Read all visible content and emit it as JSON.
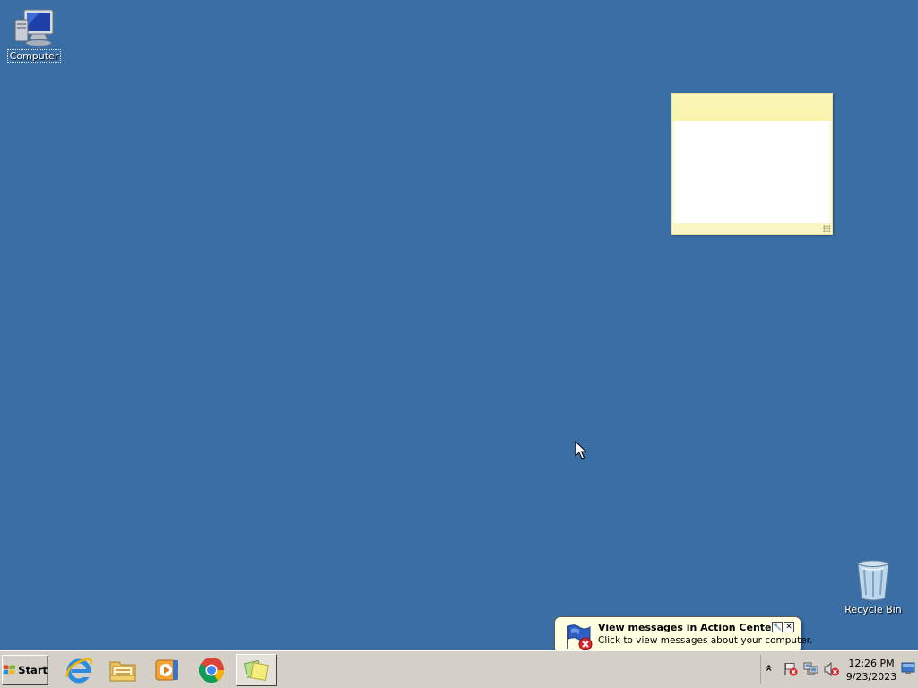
{
  "desktop": {
    "background": "#3a6ea5",
    "icons": [
      {
        "label": "Computer",
        "icon": "computer-icon"
      },
      {
        "label": "Recycle Bin",
        "icon": "recycle-bin-icon"
      }
    ]
  },
  "notification": {
    "title": "View messages in Action Center",
    "text": "Click to view messages about your computer.",
    "icon": "action-center-flag-icon",
    "options_glyph": "🔧",
    "close_glyph": "✕"
  },
  "taskbar": {
    "start_label": "Start",
    "pinned": [
      {
        "name": "Internet Explorer",
        "icon": "internet-explorer-icon"
      },
      {
        "name": "Windows Explorer",
        "icon": "file-explorer-icon"
      },
      {
        "name": "Windows Media Player",
        "icon": "media-player-icon"
      },
      {
        "name": "Google Chrome",
        "icon": "chrome-icon"
      },
      {
        "name": "Sticky Notes",
        "icon": "sticky-notes-icon"
      }
    ],
    "tray": {
      "show_hidden_glyph": "»",
      "icons": [
        "action-center-icon",
        "network-icon",
        "volume-muted-icon"
      ],
      "time": "12:26 PM",
      "date": "9/23/2023"
    }
  }
}
